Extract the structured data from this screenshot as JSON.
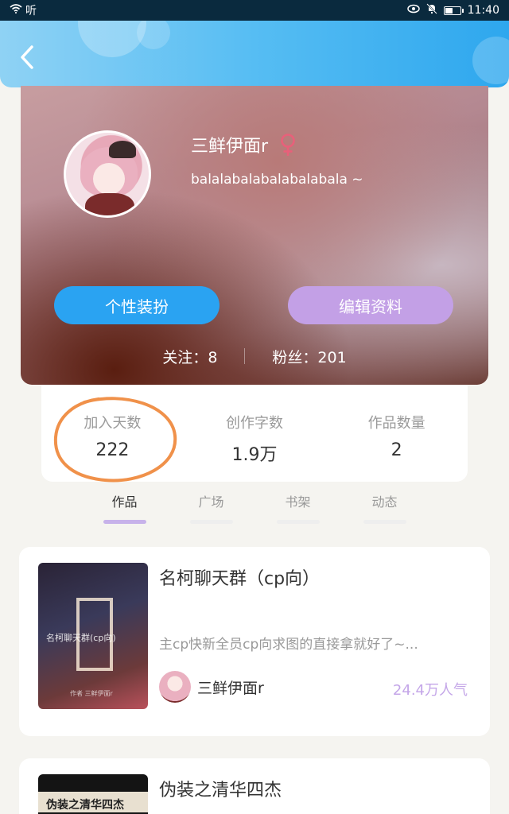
{
  "status_bar": {
    "carrier_text": "听",
    "time": "11:40"
  },
  "profile": {
    "username": "三鲜伊面r",
    "bio": "balalabalabalabalabala ~",
    "buttons": {
      "dress_up": "个性装扮",
      "edit_profile": "编辑资料"
    },
    "following_label": "关注：",
    "following_count": "8",
    "fans_label": "粉丝：",
    "fans_count": "201"
  },
  "stats": [
    {
      "label": "加入天数",
      "value": "222"
    },
    {
      "label": "创作字数",
      "value": "1.9万"
    },
    {
      "label": "作品数量",
      "value": "2"
    }
  ],
  "tabs": [
    {
      "label": "作品",
      "active": true
    },
    {
      "label": "广场",
      "active": false
    },
    {
      "label": "书架",
      "active": false
    },
    {
      "label": "动态",
      "active": false
    }
  ],
  "works": [
    {
      "title": "名柯聊天群（cp向）",
      "description": "主cp快新全员cp向求图的直接拿就好了~...",
      "author": "三鲜伊面r",
      "popularity": "24.4万人气",
      "cover_text": "名柯聊天群(cp向)",
      "cover_author": "作者 三鲜伊面r"
    },
    {
      "title": "伪装之清华四杰",
      "cover_text": "伪装之清华四杰"
    }
  ],
  "colors": {
    "header_blue": "#2ea7ee",
    "dress_button": "#2aa3f2",
    "edit_button": "#c3a0e6",
    "gender_female": "#e8607a",
    "popularity": "#c4a6e8",
    "annotation_circle": "#f0914a"
  }
}
